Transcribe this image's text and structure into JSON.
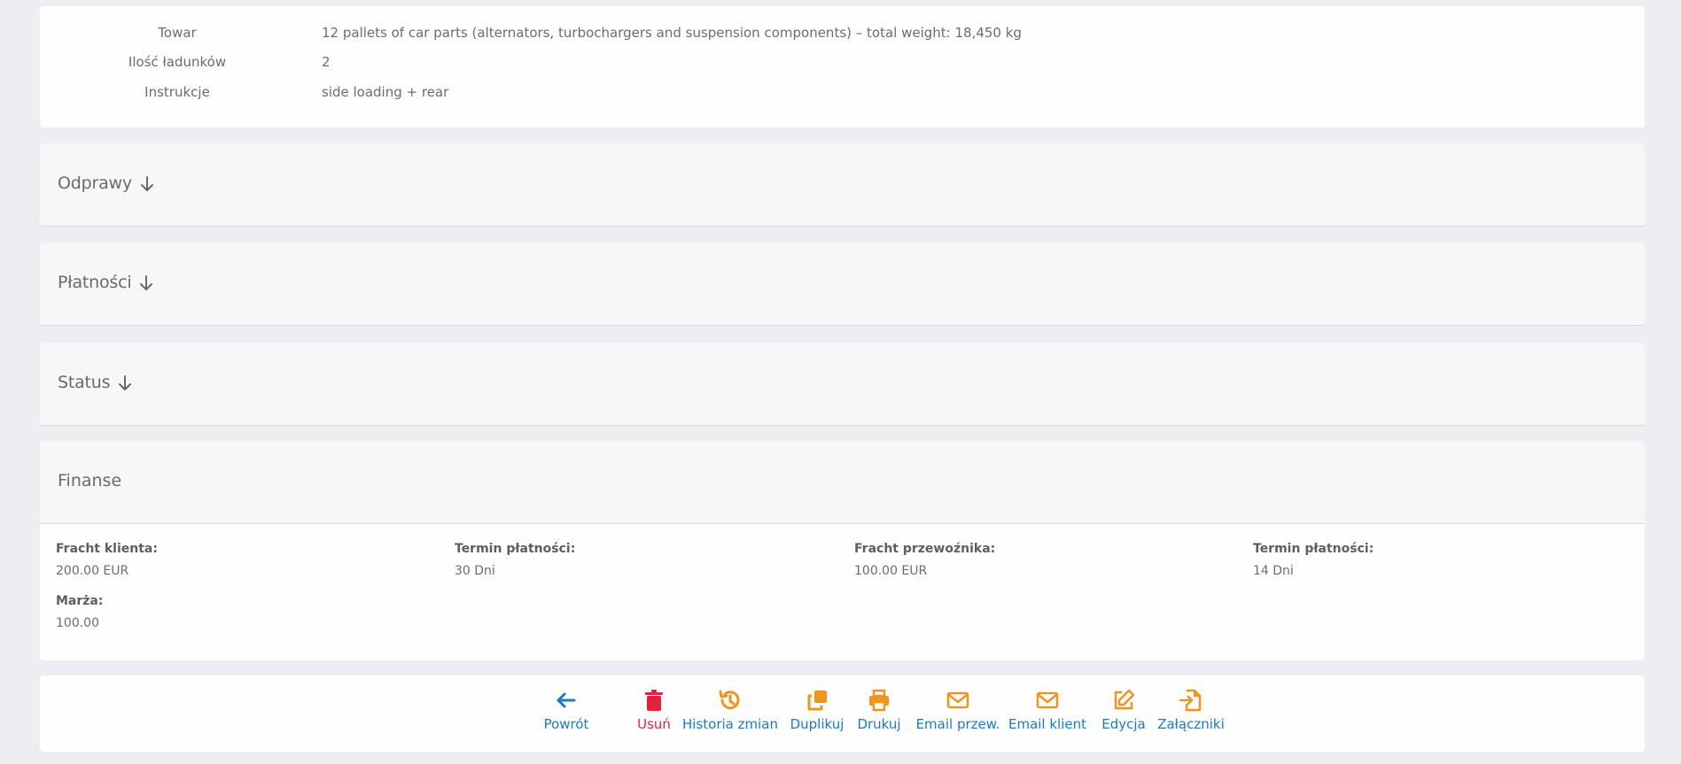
{
  "details": {
    "rows": [
      {
        "label": "Towar",
        "value": "12 pallets of car parts (alternators, turbochargers and suspension components) – total weight: 18,450 kg"
      },
      {
        "label": "Ilość ładunków",
        "value": "2"
      },
      {
        "label": "Instrukcje",
        "value": "side loading + rear"
      }
    ]
  },
  "sections": {
    "odprawy": "Odprawy",
    "platnosci": "Płatności",
    "status": "Status"
  },
  "finanse": {
    "title": "Finanse",
    "fracht_klienta_label": "Fracht klienta:",
    "fracht_klienta_value": "200.00 EUR",
    "termin_klienta_label": "Termin płatności:",
    "termin_klienta_value": "30 Dni",
    "fracht_przewoznika_label": "Fracht przewoźnika:",
    "fracht_przewoznika_value": "100.00 EUR",
    "termin_przewoznika_label": "Termin płatności:",
    "termin_przewoznika_value": "14 Dni",
    "marza_label": "Marża:",
    "marza_value": "100.00"
  },
  "toolbar": {
    "powrot": "Powrót",
    "usun": "Usuń",
    "historia": "Historia zmian",
    "duplikuj": "Duplikuj",
    "drukuj": "Drukuj",
    "email_przew": "Email przew.",
    "email_klient": "Email klient",
    "edycja": "Edycja",
    "zalaczniki": "Załączniki"
  },
  "colors": {
    "link_blue": "#1b7ac8",
    "action_orange": "#f0941c",
    "danger_red": "#e0233a",
    "page_bg": "#eceef2"
  },
  "icons": {
    "powrot": "arrow-left-icon",
    "usun": "trash-icon",
    "historia": "history-icon",
    "duplikuj": "copy-icon",
    "drukuj": "printer-icon",
    "email_przew": "envelope-icon",
    "email_klient": "envelope-icon",
    "edycja": "edit-icon",
    "zalaczniki": "file-import-icon"
  }
}
